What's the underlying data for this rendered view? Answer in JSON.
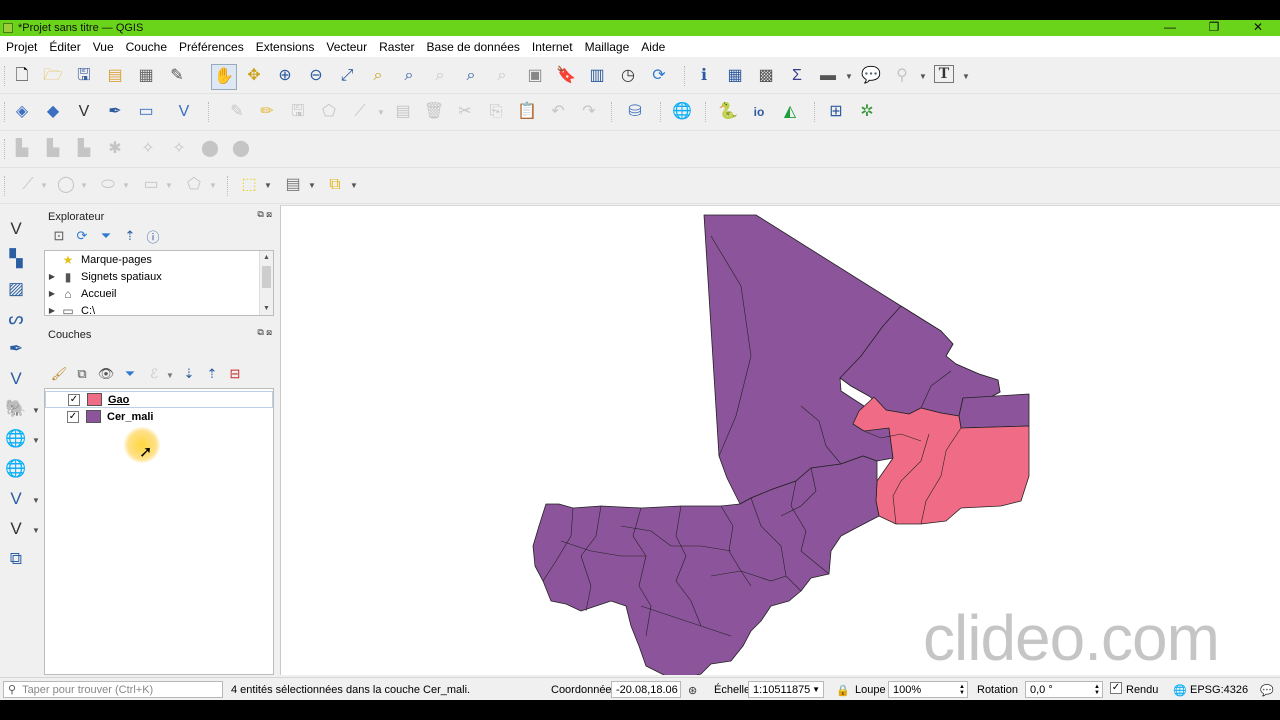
{
  "window": {
    "title": "*Projet sans titre — QGIS",
    "min": "—",
    "max": "❐",
    "close": "✕"
  },
  "menu": [
    "Projet",
    "Éditer",
    "Vue",
    "Couche",
    "Préférences",
    "Extensions",
    "Vecteur",
    "Raster",
    "Base de données",
    "Internet",
    "Maillage",
    "Aide"
  ],
  "browser": {
    "title": "Explorateur",
    "items": [
      {
        "label": "Marque-pages",
        "icon": "star-icon"
      },
      {
        "label": "Signets spatiaux",
        "icon": "bookmark-icon"
      },
      {
        "label": "Accueil",
        "icon": "home-folder-icon"
      },
      {
        "label": "C:\\",
        "icon": "drive-icon"
      }
    ]
  },
  "layers": {
    "title": "Couches",
    "items": [
      {
        "name": "Gao",
        "checked": true,
        "color": "#f06b86"
      },
      {
        "name": "Cer_mali",
        "checked": true,
        "color": "#8c549b"
      }
    ]
  },
  "map": {
    "fill_main": "#8c549b",
    "fill_selected": "#f06b86",
    "stroke": "#222222"
  },
  "watermark": "clideo.com",
  "status": {
    "search_placeholder": "Taper pour trouver (Ctrl+K)",
    "message": "4 entités sélectionnées dans la couche Cer_mali.",
    "coord_label": "Coordonnée",
    "coord_value": "-20.08,18.06",
    "scale_label": "Échelle",
    "scale_value": "1:10511875",
    "zoom_label": "Loupe",
    "zoom_value": "100%",
    "rotation_label": "Rotation",
    "rotation_value": "0,0 °",
    "render_label": "Rendu",
    "crs": "EPSG:4326"
  }
}
